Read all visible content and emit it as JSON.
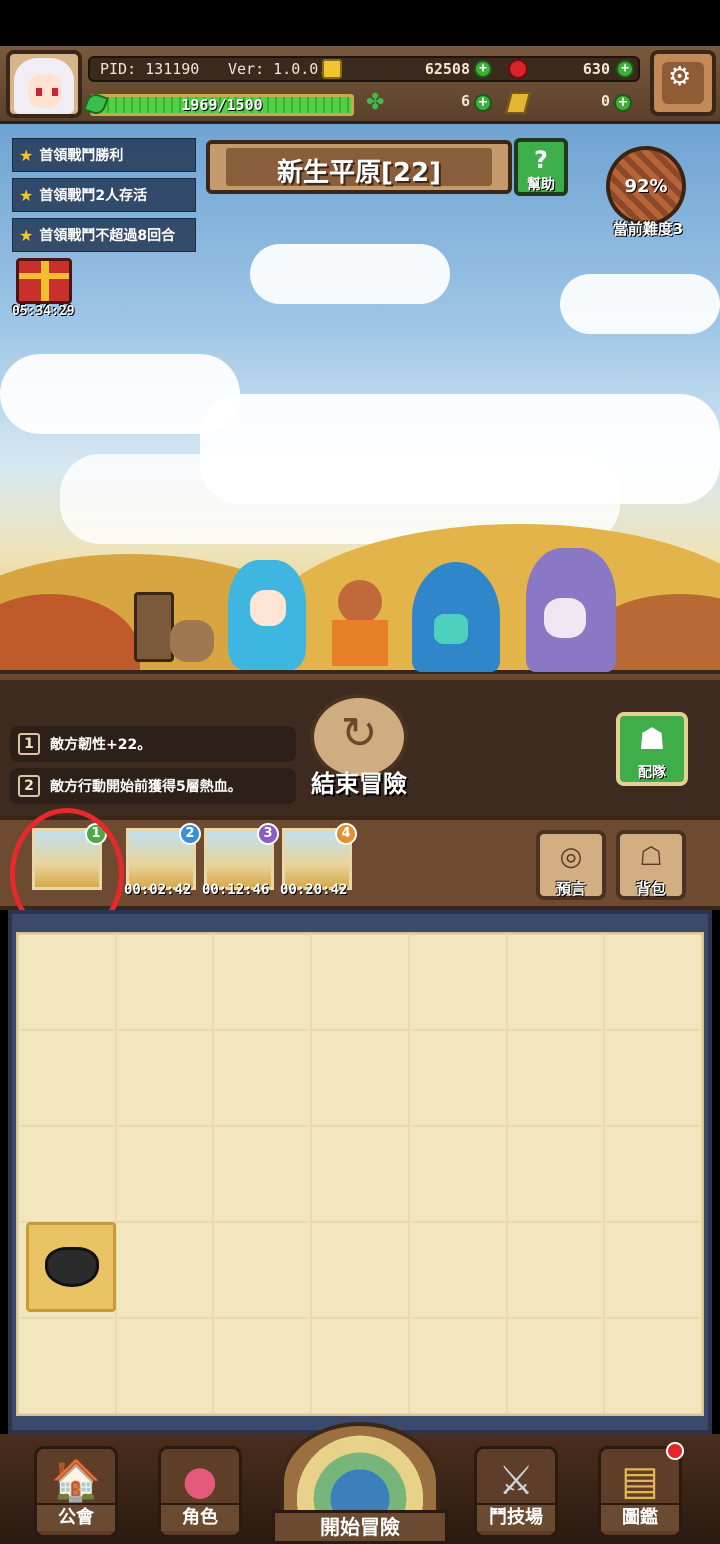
{
  "header": {
    "pid": "PID: 131190",
    "version": "Ver: 1.0.0.0",
    "gold": "62508",
    "gems": "630",
    "xp": "1969/1500",
    "xp_fraction": 1.0,
    "clover": "6",
    "keys": "0",
    "icons": {
      "coin": "coin-icon",
      "gem": "gem-icon",
      "clover": "clover-icon",
      "key": "key-icon",
      "settings": "gear-icon"
    }
  },
  "quests": [
    {
      "text": "首領戰鬥勝利"
    },
    {
      "text": "首領戰鬥2人存活"
    },
    {
      "text": "首領戰鬥不超過8回合"
    }
  ],
  "gift": {
    "timer": "05:34:29"
  },
  "stage": {
    "title": "新生平原[22]",
    "help_label": "幫助"
  },
  "difficulty": {
    "percent": "92%",
    "label": "當前難度3"
  },
  "buffs": [
    {
      "num": "1",
      "text": "敵方韌性+22。"
    },
    {
      "num": "2",
      "text": "敵方行動開始前獲得5層熱血。"
    }
  ],
  "controls": {
    "end_label": "結束冒險",
    "team_label": "配隊"
  },
  "level_tabs": [
    {
      "badge": "1",
      "color": "#4fa84a",
      "timer": ""
    },
    {
      "badge": "2",
      "color": "#3b8fd6",
      "timer": "00:02:42"
    },
    {
      "badge": "3",
      "color": "#8a5cc6",
      "timer": "00:12:46"
    },
    {
      "badge": "4",
      "color": "#e0902e",
      "timer": "00:20:42"
    }
  ],
  "side_buttons": {
    "prophecy": "預言",
    "bag": "背包"
  },
  "nav": {
    "guild": "公會",
    "character": "角色",
    "start": "開始冒險",
    "arena": "鬥技場",
    "codex": "圖鑑"
  }
}
